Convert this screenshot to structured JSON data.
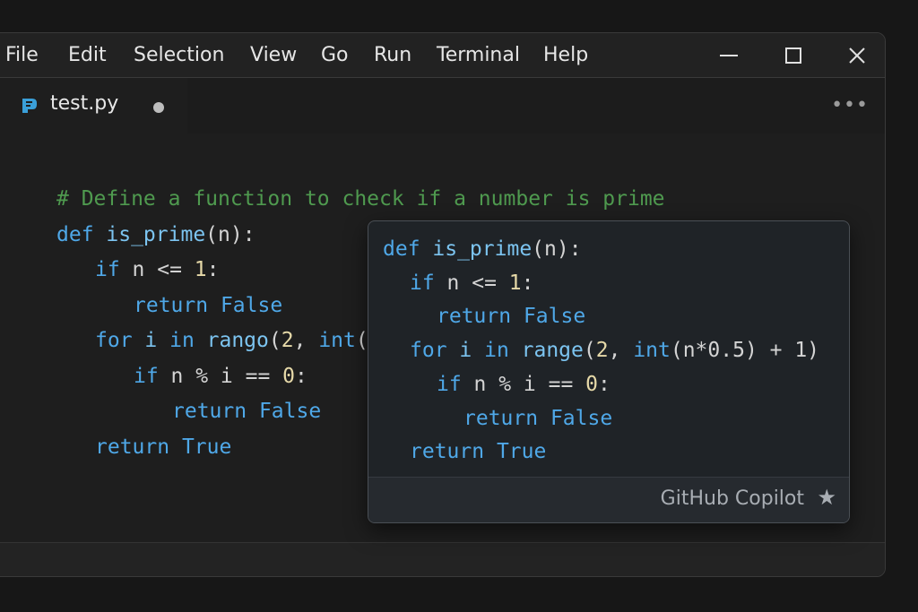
{
  "menu": {
    "items": [
      "File",
      "Edit",
      "Selection",
      "View",
      "Go",
      "Run",
      "Terminal",
      "Help"
    ]
  },
  "window_controls": {
    "minimize_icon": "minimize-icon",
    "maximize_icon": "maximize-icon",
    "close_icon": "close-icon"
  },
  "tab": {
    "label": "test.py",
    "icon": "python-file-icon",
    "modified_indicator": "dot",
    "more_icon": "more-actions-icon",
    "more_glyph": "•••"
  },
  "editor": {
    "lines": [
      {
        "indent": 0,
        "tokens": [
          {
            "t": "# Define a function to check if a number is prime",
            "c": "cmt"
          }
        ]
      },
      {
        "indent": 0,
        "tokens": [
          {
            "t": "def ",
            "c": "kw"
          },
          {
            "t": "is_prime",
            "c": "fn"
          },
          {
            "t": "(n):",
            "c": "txt"
          }
        ]
      },
      {
        "indent": 1,
        "tokens": [
          {
            "t": "if ",
            "c": "kw"
          },
          {
            "t": "n <= ",
            "c": "txt"
          },
          {
            "t": "1",
            "c": "num"
          },
          {
            "t": ":",
            "c": "txt"
          }
        ]
      },
      {
        "indent": 2,
        "tokens": [
          {
            "t": "return ",
            "c": "kw"
          },
          {
            "t": "False",
            "c": "kw"
          }
        ]
      },
      {
        "indent": 1,
        "tokens": [
          {
            "t": "for ",
            "c": "kw"
          },
          {
            "t": "i ",
            "c": "fn"
          },
          {
            "t": "in ",
            "c": "kw"
          },
          {
            "t": "rango",
            "c": "fn"
          },
          {
            "t": "(",
            "c": "txt"
          },
          {
            "t": "2",
            "c": "num"
          },
          {
            "t": ", ",
            "c": "txt"
          },
          {
            "t": "int",
            "c": "kw"
          },
          {
            "t": "(",
            "c": "txt"
          }
        ]
      },
      {
        "indent": 2,
        "tokens": [
          {
            "t": "if ",
            "c": "kw"
          },
          {
            "t": "n % i == ",
            "c": "txt"
          },
          {
            "t": "0",
            "c": "num"
          },
          {
            "t": ":",
            "c": "txt"
          }
        ]
      },
      {
        "indent": 3,
        "tokens": [
          {
            "t": "return ",
            "c": "kw"
          },
          {
            "t": "False",
            "c": "kw"
          }
        ]
      },
      {
        "indent": 1,
        "tokens": [
          {
            "t": "return ",
            "c": "kw"
          },
          {
            "t": "True",
            "c": "kw"
          }
        ]
      }
    ]
  },
  "suggestion": {
    "lines": [
      {
        "indent": 0,
        "tokens": [
          {
            "t": "def ",
            "c": "kw"
          },
          {
            "t": "is_prime",
            "c": "fn"
          },
          {
            "t": "(n):",
            "c": "txt"
          }
        ]
      },
      {
        "indent": 1,
        "tokens": [
          {
            "t": "if ",
            "c": "kw"
          },
          {
            "t": "n <= ",
            "c": "txt"
          },
          {
            "t": "1",
            "c": "num"
          },
          {
            "t": ":",
            "c": "txt"
          }
        ]
      },
      {
        "indent": 2,
        "tokens": [
          {
            "t": "return ",
            "c": "kw"
          },
          {
            "t": "False",
            "c": "kw"
          }
        ]
      },
      {
        "indent": 1,
        "tokens": [
          {
            "t": "for ",
            "c": "kw"
          },
          {
            "t": "i ",
            "c": "fn"
          },
          {
            "t": "in ",
            "c": "kw"
          },
          {
            "t": "range",
            "c": "fn"
          },
          {
            "t": "(",
            "c": "txt"
          },
          {
            "t": "2",
            "c": "num"
          },
          {
            "t": ", ",
            "c": "txt"
          },
          {
            "t": "int",
            "c": "kw"
          },
          {
            "t": "(n*0.5) + 1)",
            "c": "txt"
          }
        ]
      },
      {
        "indent": 2,
        "tokens": [
          {
            "t": "if ",
            "c": "kw"
          },
          {
            "t": "n % i == ",
            "c": "txt"
          },
          {
            "t": "0",
            "c": "num"
          },
          {
            "t": ":",
            "c": "txt"
          }
        ]
      },
      {
        "indent": 3,
        "tokens": [
          {
            "t": "return ",
            "c": "kw"
          },
          {
            "t": "False",
            "c": "kw"
          }
        ]
      },
      {
        "indent": 1,
        "tokens": [
          {
            "t": "return ",
            "c": "kw"
          },
          {
            "t": "True",
            "c": "kw"
          }
        ]
      }
    ],
    "footer_label": "GitHub Copilot",
    "footer_icon": "star-icon",
    "footer_glyph": "★"
  },
  "colors": {
    "keyword": "#4fa8e8",
    "comment": "#4f9a4f",
    "number": "#e6d9a8",
    "text": "#d4d4d4",
    "background": "#1e1e1e"
  }
}
